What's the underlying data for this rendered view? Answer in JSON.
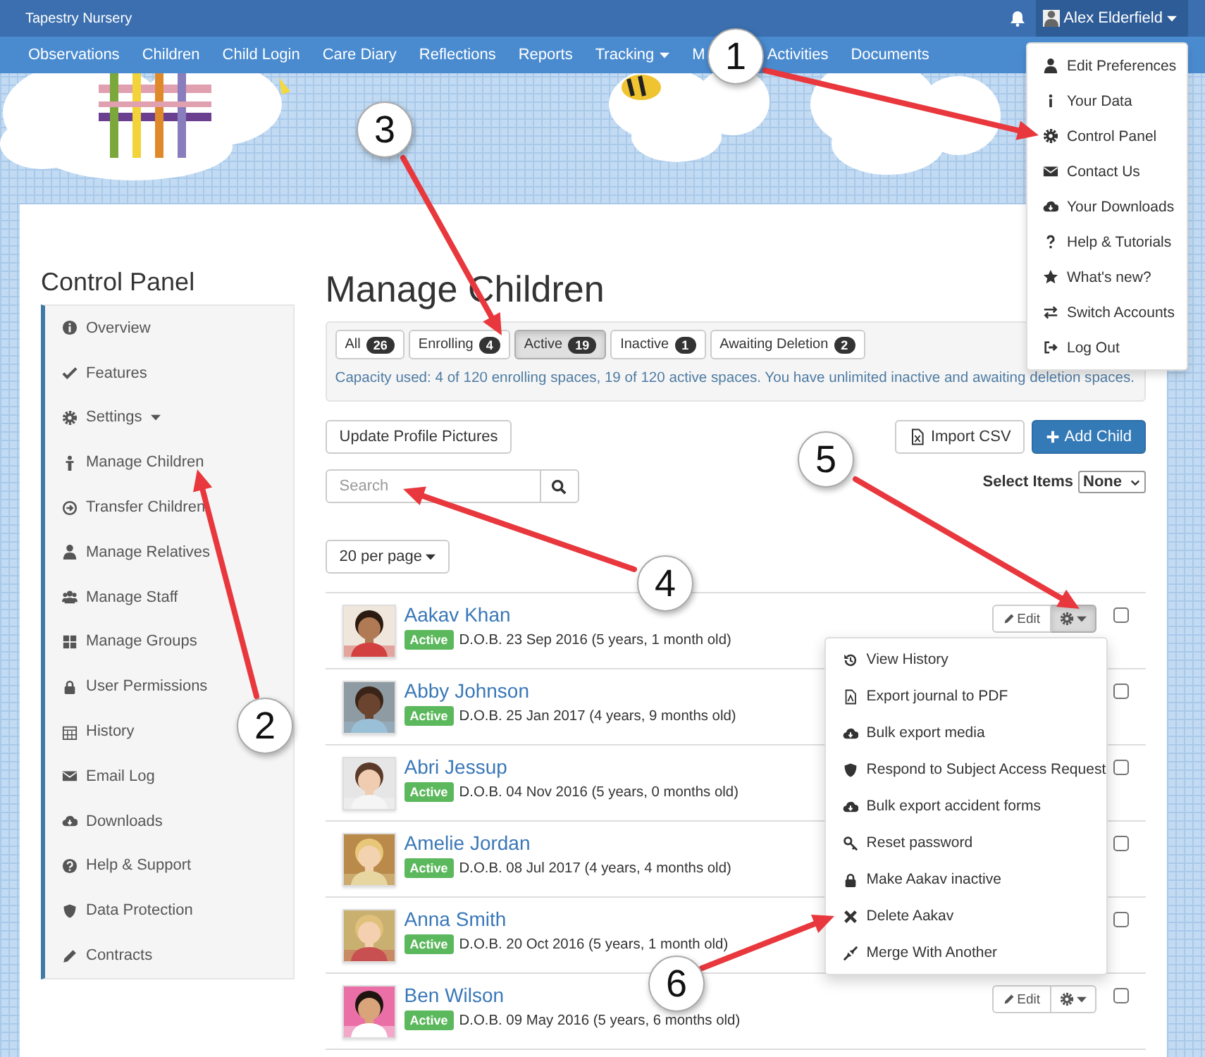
{
  "topbar": {
    "brand": "Tapestry Nursery",
    "user": "Alex Elderfield",
    "user_menu_open": true
  },
  "nav": [
    {
      "label": "Observations",
      "dropdown": false
    },
    {
      "label": "Children",
      "dropdown": false
    },
    {
      "label": "Child Login",
      "dropdown": false
    },
    {
      "label": "Care Diary",
      "dropdown": false
    },
    {
      "label": "Reflections",
      "dropdown": false
    },
    {
      "label": "Reports",
      "dropdown": false
    },
    {
      "label": "Tracking",
      "dropdown": true
    },
    {
      "label": "M",
      "dropdown": false
    },
    {
      "label": "Activities",
      "dropdown": false
    },
    {
      "label": "Documents",
      "dropdown": false
    }
  ],
  "user_menu": [
    "Edit Preferences",
    "Your Data",
    "Control Panel",
    "Contact Us",
    "Your Downloads",
    "Help & Tutorials",
    "What's new?",
    "Switch Accounts",
    "Log Out"
  ],
  "sidebar": {
    "title": "Control Panel",
    "items": [
      {
        "label": "Overview",
        "dropdown": false
      },
      {
        "label": "Features",
        "dropdown": false
      },
      {
        "label": "Settings",
        "dropdown": true
      },
      {
        "label": "Manage Children",
        "dropdown": false
      },
      {
        "label": "Transfer Children",
        "dropdown": false
      },
      {
        "label": "Manage Relatives",
        "dropdown": false
      },
      {
        "label": "Manage Staff",
        "dropdown": false
      },
      {
        "label": "Manage Groups",
        "dropdown": false
      },
      {
        "label": "User Permissions",
        "dropdown": false
      },
      {
        "label": "History",
        "dropdown": false
      },
      {
        "label": "Email Log",
        "dropdown": false
      },
      {
        "label": "Downloads",
        "dropdown": false
      },
      {
        "label": "Help & Support",
        "dropdown": false
      },
      {
        "label": "Data Protection",
        "dropdown": false
      },
      {
        "label": "Contracts",
        "dropdown": false
      }
    ]
  },
  "main": {
    "title": "Manage Children",
    "filters": {
      "tabs": [
        {
          "label": "All",
          "count": "26",
          "selected": false
        },
        {
          "label": "Enrolling",
          "count": "4",
          "selected": false
        },
        {
          "label": "Active",
          "count": "19",
          "selected": true
        },
        {
          "label": "Inactive",
          "count": "1",
          "selected": false
        },
        {
          "label": "Awaiting Deletion",
          "count": "2",
          "selected": false
        }
      ],
      "capacity": "Capacity used: 4 of 120 enrolling spaces, 19 of 120 active spaces. You have unlimited inactive and awaiting deletion spaces."
    },
    "update_pictures": "Update Profile Pictures",
    "import_csv": "Import CSV",
    "add_child": "Add Child",
    "select_items": {
      "label": "Select Items",
      "value": "None"
    },
    "search": {
      "placeholder": "Search"
    },
    "per_page": "20 per page"
  },
  "children": [
    {
      "name": "Aakav Khan",
      "status": "Active",
      "dob": "D.O.B. 23 Sep 2016 (5 years, 1 month old)",
      "edit_label": "Edit",
      "menu_open": true,
      "checked": false
    },
    {
      "name": "Abby Johnson",
      "status": "Active",
      "dob": "D.O.B. 25 Jan 2017 (4 years, 9 months old)",
      "checked": false
    },
    {
      "name": "Abri Jessup",
      "status": "Active",
      "dob": "D.O.B. 04 Nov 2016 (5 years, 0 months old)",
      "checked": false
    },
    {
      "name": "Amelie Jordan",
      "status": "Active",
      "dob": "D.O.B. 08 Jul 2017 (4 years, 4 months old)",
      "checked": false
    },
    {
      "name": "Anna Smith",
      "status": "Active",
      "dob": "D.O.B. 20 Oct 2016 (5 years, 1 month old)",
      "checked": false
    },
    {
      "name": "Ben Wilson",
      "status": "Active",
      "dob": "D.O.B. 09 May 2016 (5 years, 6 months old)",
      "edit_label": "Edit",
      "menu_open": false,
      "checked": false
    }
  ],
  "row_menu": [
    "View History",
    "Export journal to PDF",
    "Bulk export media",
    "Respond to Subject Access Request",
    "Bulk export accident forms",
    "Reset password",
    "Make Aakav inactive",
    "Delete Aakav",
    "Merge With Another"
  ],
  "callouts": [
    "1",
    "2",
    "3",
    "4",
    "5",
    "6"
  ]
}
